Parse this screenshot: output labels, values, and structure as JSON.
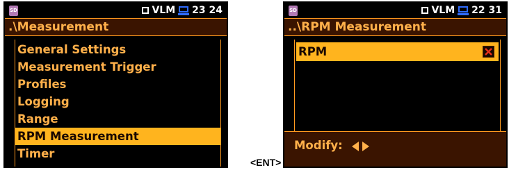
{
  "left_screen": {
    "status": {
      "sd_icon": "SD",
      "mode_label": "VLM",
      "time": "23 24"
    },
    "title": ".\\Measurement",
    "menu_items": [
      {
        "label": "General Settings",
        "selected": false
      },
      {
        "label": "Measurement Trigger",
        "selected": false
      },
      {
        "label": "Profiles",
        "selected": false
      },
      {
        "label": "Logging",
        "selected": false
      },
      {
        "label": "Range",
        "selected": false
      },
      {
        "label": "RPM Measurement",
        "selected": true
      },
      {
        "label": "Timer",
        "selected": false
      }
    ]
  },
  "right_screen": {
    "status": {
      "sd_icon": "SD",
      "mode_label": "VLM",
      "time": "22 31"
    },
    "title": "..\\RPM Measurement",
    "rpm_row": {
      "label": "RPM",
      "checked": false
    },
    "modify_label": "Modify:"
  },
  "key_hint": "<ENT>",
  "colors": {
    "text": "#ffb04a",
    "highlight": "#ffb41e",
    "title_bg": "#3a1400",
    "screen_bg": "#000000",
    "pc_icon": "#2f6bff",
    "uncheck_mark": "#e8301a"
  },
  "icons": [
    "sd-card-icon",
    "checkbox-icon",
    "pc-connection-icon",
    "unchecked-x-icon",
    "arrow-left-icon",
    "arrow-right-icon"
  ]
}
